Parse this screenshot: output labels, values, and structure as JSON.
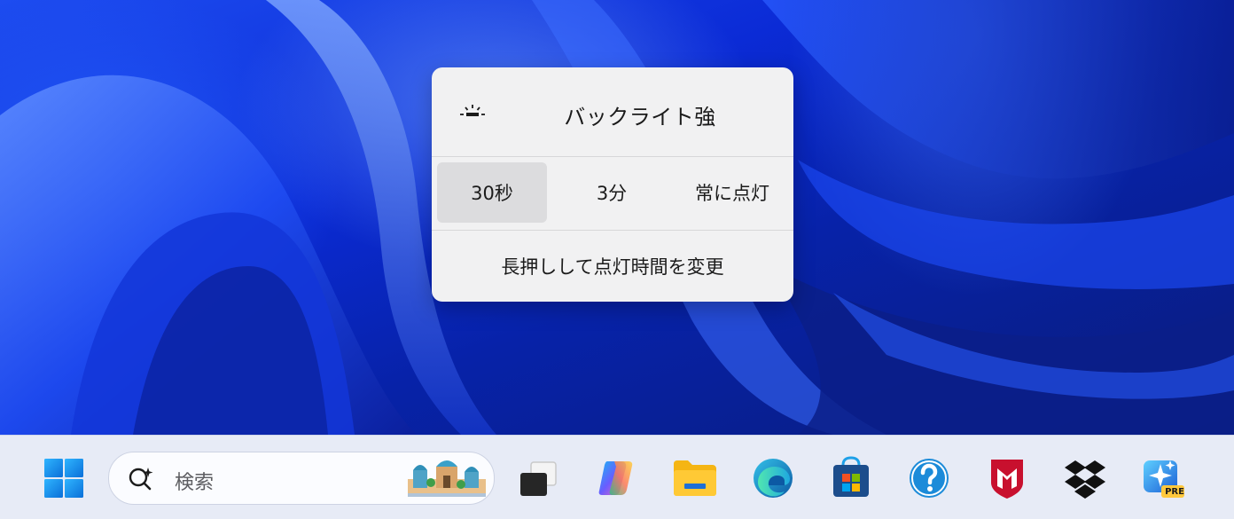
{
  "flyout": {
    "title": "バックライト強",
    "icon": "backlight-icon",
    "options": [
      {
        "label": "30秒",
        "selected": true
      },
      {
        "label": "3分",
        "selected": false
      },
      {
        "label": "常に点灯",
        "selected": false
      }
    ],
    "footer": "長押しして点灯時間を変更"
  },
  "taskbar": {
    "search": {
      "placeholder": "検索"
    },
    "apps": [
      {
        "name": "start",
        "icon": "windows-logo-icon"
      },
      {
        "name": "task-view",
        "icon": "task-view-icon"
      },
      {
        "name": "copilot",
        "icon": "copilot-icon"
      },
      {
        "name": "file-explorer",
        "icon": "folder-icon"
      },
      {
        "name": "edge",
        "icon": "edge-icon"
      },
      {
        "name": "microsoft-store",
        "icon": "store-icon"
      },
      {
        "name": "get-help",
        "icon": "help-icon"
      },
      {
        "name": "mcafee",
        "icon": "mcafee-icon"
      },
      {
        "name": "dropbox",
        "icon": "dropbox-icon"
      },
      {
        "name": "designer-preview",
        "icon": "designer-pre-icon",
        "badge": "PRE"
      }
    ]
  },
  "colors": {
    "accent": "#0067c0",
    "flyout_bg": "#f1f1f2",
    "selected_bg": "#dcdcde",
    "taskbar_bg": "#e7ebf6"
  }
}
